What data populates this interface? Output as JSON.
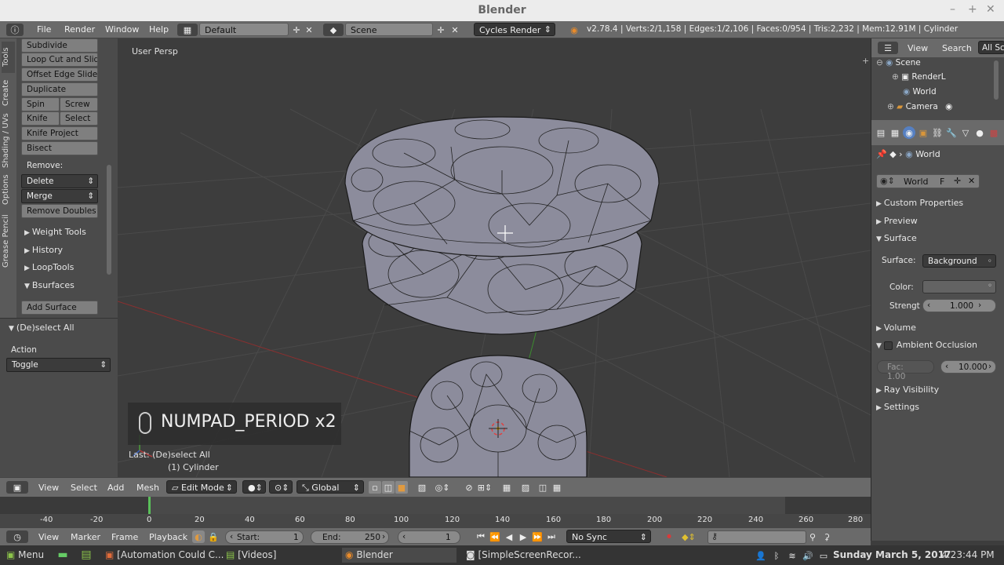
{
  "window": {
    "title": "Blender"
  },
  "topbar": {
    "menus": [
      "File",
      "Render",
      "Window",
      "Help"
    ],
    "layout": "Default",
    "scene": "Scene",
    "engine": "Cycles Render",
    "stats": "v2.78.4 | Verts:2/1,158 | Edges:1/2,106 | Faces:0/954 | Tris:2,232 | Mem:12.91M | Cylinder"
  },
  "tool_tabs": [
    "Tools",
    "Create",
    "Shading / UVs",
    "Options",
    "Grease Pencil"
  ],
  "tools": {
    "subdivide": "Subdivide",
    "loop_cut": "Loop Cut and Slide",
    "offset_edge": "Offset Edge Slide",
    "duplicate": "Duplicate",
    "spin": "Spin",
    "screw": "Screw",
    "knife": "Knife",
    "select": "Select",
    "knife_project": "Knife Project",
    "bisect": "Bisect",
    "remove_label": "Remove:",
    "delete": "Delete",
    "merge": "Merge",
    "remove_doubles": "Remove Doubles",
    "weight_tools": "Weight Tools",
    "history": "History",
    "looptools": "LoopTools",
    "bsurfaces": "Bsurfaces",
    "add_surface": "Add Surface"
  },
  "operator": {
    "title": "(De)select All",
    "action_label": "Action",
    "action_value": "Toggle"
  },
  "viewport": {
    "view_name": "User Persp",
    "key_display": "NUMPAD_PERIOD x2",
    "last_op": "Last: (De)select All",
    "object": "(1) Cylinder"
  },
  "outliner": {
    "view": "View",
    "search": "Search",
    "all": "All Sc",
    "items": [
      "Scene",
      "RenderL",
      "World",
      "Camera"
    ]
  },
  "properties": {
    "crumb": "World",
    "world_name": "World",
    "f_label": "F",
    "panels": {
      "custom_props": "Custom Properties",
      "preview": "Preview",
      "surface": "Surface",
      "volume": "Volume",
      "ao": "Ambient Occlusion",
      "ray_vis": "Ray Visibility",
      "settings": "Settings"
    },
    "surface_label": "Surface:",
    "surface_value": "Background",
    "color_label": "Color:",
    "color_value": "#636363",
    "strength_label": "Strengt",
    "strength_value": "1.000",
    "ao_factor": "Fac: 1.00",
    "ao_distance": "10.000"
  },
  "view3d_header": {
    "menus": [
      "View",
      "Select",
      "Add",
      "Mesh"
    ],
    "mode": "Edit Mode",
    "orientation": "Global"
  },
  "timeline": {
    "ticks": [
      "-40",
      "-20",
      "0",
      "20",
      "40",
      "60",
      "80",
      "100",
      "120",
      "140",
      "160",
      "180",
      "200",
      "220",
      "240",
      "260",
      "280"
    ],
    "menus": [
      "View",
      "Marker",
      "Frame",
      "Playback"
    ],
    "start_label": "Start:",
    "start_value": "1",
    "end_label": "End:",
    "end_value": "250",
    "current": "1",
    "sync": "No Sync"
  },
  "taskbar": {
    "menu": "Menu",
    "tasks": [
      "[Automation Could C...",
      "[Videos]",
      "Blender",
      "[SimpleScreenRecor..."
    ],
    "clock": "Sunday March  5, 2017",
    "time": "4:23:44 PM"
  }
}
